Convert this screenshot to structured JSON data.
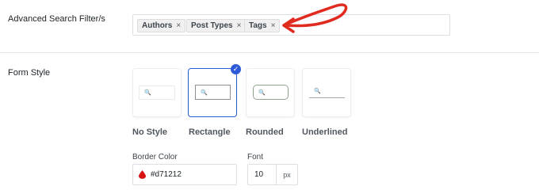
{
  "colors": {
    "accent": "#2d5bd7",
    "arrow": "#e02b20",
    "border_color_swatch": "#d71212"
  },
  "filters": {
    "label": "Advanced Search Filter/s",
    "tags": [
      "Authors",
      "Post Types",
      "Tags"
    ],
    "remove_icon": "×"
  },
  "form_style": {
    "label": "Form Style",
    "options": [
      {
        "label": "No Style",
        "selected": false
      },
      {
        "label": "Rectangle",
        "selected": true
      },
      {
        "label": "Rounded",
        "selected": false
      },
      {
        "label": "Underlined",
        "selected": false
      }
    ],
    "check_icon": "✓",
    "search_icon": "🔍"
  },
  "border_color": {
    "label": "Border Color",
    "value": "#d71212",
    "icon": "droplet-icon"
  },
  "font": {
    "label": "Font",
    "value": "10",
    "unit": "px"
  }
}
